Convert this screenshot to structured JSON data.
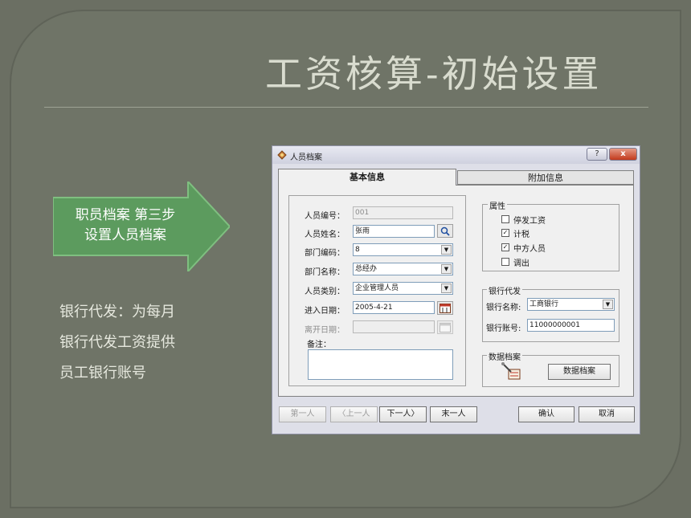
{
  "slide": {
    "title": "工资核算-初始设置",
    "arrow_text_line1": "职员档案 第三步",
    "arrow_text_line2": "设置人员档案",
    "desc_line1": "银行代发：为每月",
    "desc_line2": "银行代发工资提供",
    "desc_line3": "员工银行账号",
    "arrow_color": "#5c9b5e"
  },
  "dialog": {
    "title": "人员档案",
    "help_btn": "?",
    "close_btn": "x",
    "tabs": [
      {
        "label": "基本信息",
        "active": true
      },
      {
        "label": "附加信息",
        "active": false
      }
    ],
    "fields": {
      "emp_no_label": "人员编号：",
      "emp_no_value": "001",
      "name_label": "人员姓名：",
      "name_value": "张雨",
      "dept_code_label": "部门编码：",
      "dept_code_value": "8",
      "dept_name_label": "部门名称：",
      "dept_name_value": "总经办",
      "category_label": "人员类别：",
      "category_value": "企业管理人员",
      "entry_date_label": "进入日期：",
      "entry_date_value": "2005-4-21",
      "leave_date_label": "离开日期：",
      "leave_date_value": "",
      "remark_label": "备注："
    },
    "attributes": {
      "title": "属性",
      "items": [
        {
          "label": "停发工资",
          "checked": false
        },
        {
          "label": "计税",
          "checked": true
        },
        {
          "label": "中方人员",
          "checked": true
        },
        {
          "label": "调出",
          "checked": false
        }
      ]
    },
    "bank": {
      "title": "银行代发",
      "bank_name_label": "银行名称:",
      "bank_name_value": "工商银行",
      "account_label": "银行账号:",
      "account_value": "11000000001"
    },
    "data_archive": {
      "title": "数据档案",
      "button": "数据档案"
    },
    "nav": {
      "first": "第一人",
      "prev": "〈上一人",
      "next": "下一人〉",
      "last": "末一人"
    },
    "ok": "确认",
    "cancel": "取消"
  }
}
